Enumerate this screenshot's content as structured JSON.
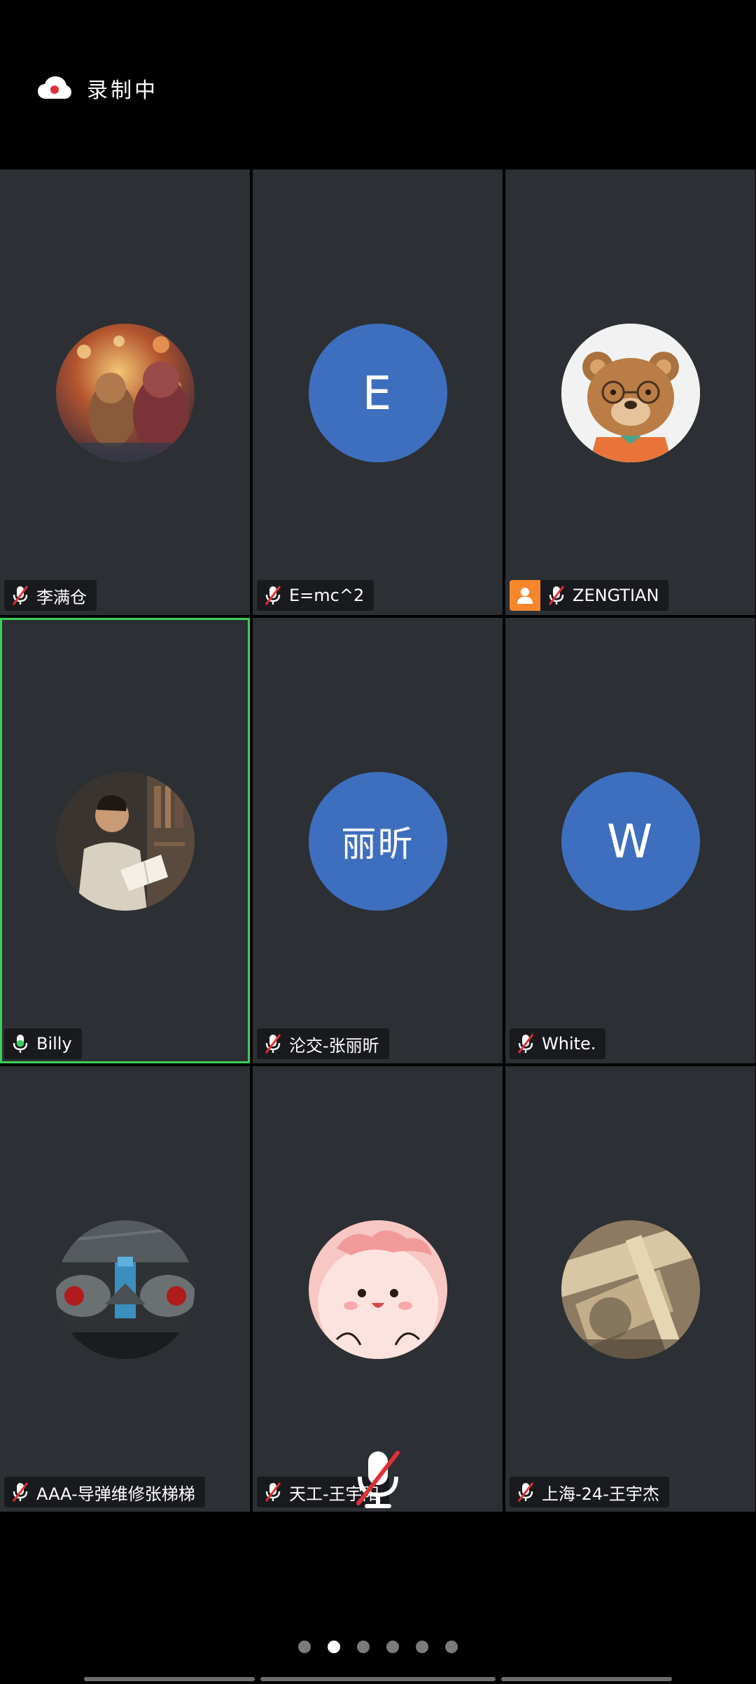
{
  "recording": {
    "label": "录制中",
    "icon": "cloud-record-icon"
  },
  "tiles": [
    {
      "name": "李满仓",
      "avatar_type": "photo",
      "avatar_icon": "lantern-photo-icon",
      "mic": "muted"
    },
    {
      "name": "E=mc^2",
      "avatar_type": "letter",
      "avatar_text": "E",
      "mic": "muted"
    },
    {
      "name": "ZENGTIAN",
      "avatar_type": "photo",
      "avatar_icon": "bear-avatar-icon",
      "mic": "muted",
      "host_badge": true
    },
    {
      "name": "Billy",
      "avatar_type": "photo",
      "avatar_icon": "reading-man-photo-icon",
      "mic": "active",
      "speaking": true
    },
    {
      "name": "沦交-张丽昕",
      "avatar_type": "letter",
      "avatar_text": "丽昕",
      "mic": "muted"
    },
    {
      "name": "White.",
      "avatar_type": "letter",
      "avatar_text": "W",
      "mic": "muted"
    },
    {
      "name": "AAA-导弹维修张梯梯",
      "avatar_type": "photo",
      "avatar_icon": "jet-engines-photo-icon",
      "mic": "muted"
    },
    {
      "name": "天工-王宇阳",
      "avatar_type": "photo",
      "avatar_icon": "pink-mascot-icon",
      "mic": "muted"
    },
    {
      "name": "上海-24-王宇杰",
      "avatar_type": "photo",
      "avatar_icon": "blurry-photo-icon",
      "mic": "muted"
    }
  ],
  "pagination": {
    "pages": 6,
    "current": 2
  },
  "colors": {
    "tile_bg": "#2c2f33",
    "letter_avatar_bg": "#3e6fbf",
    "speaking_border": "#3bcf5a",
    "host_badge": "#f5862a",
    "muted_slash": "#e0303a"
  }
}
